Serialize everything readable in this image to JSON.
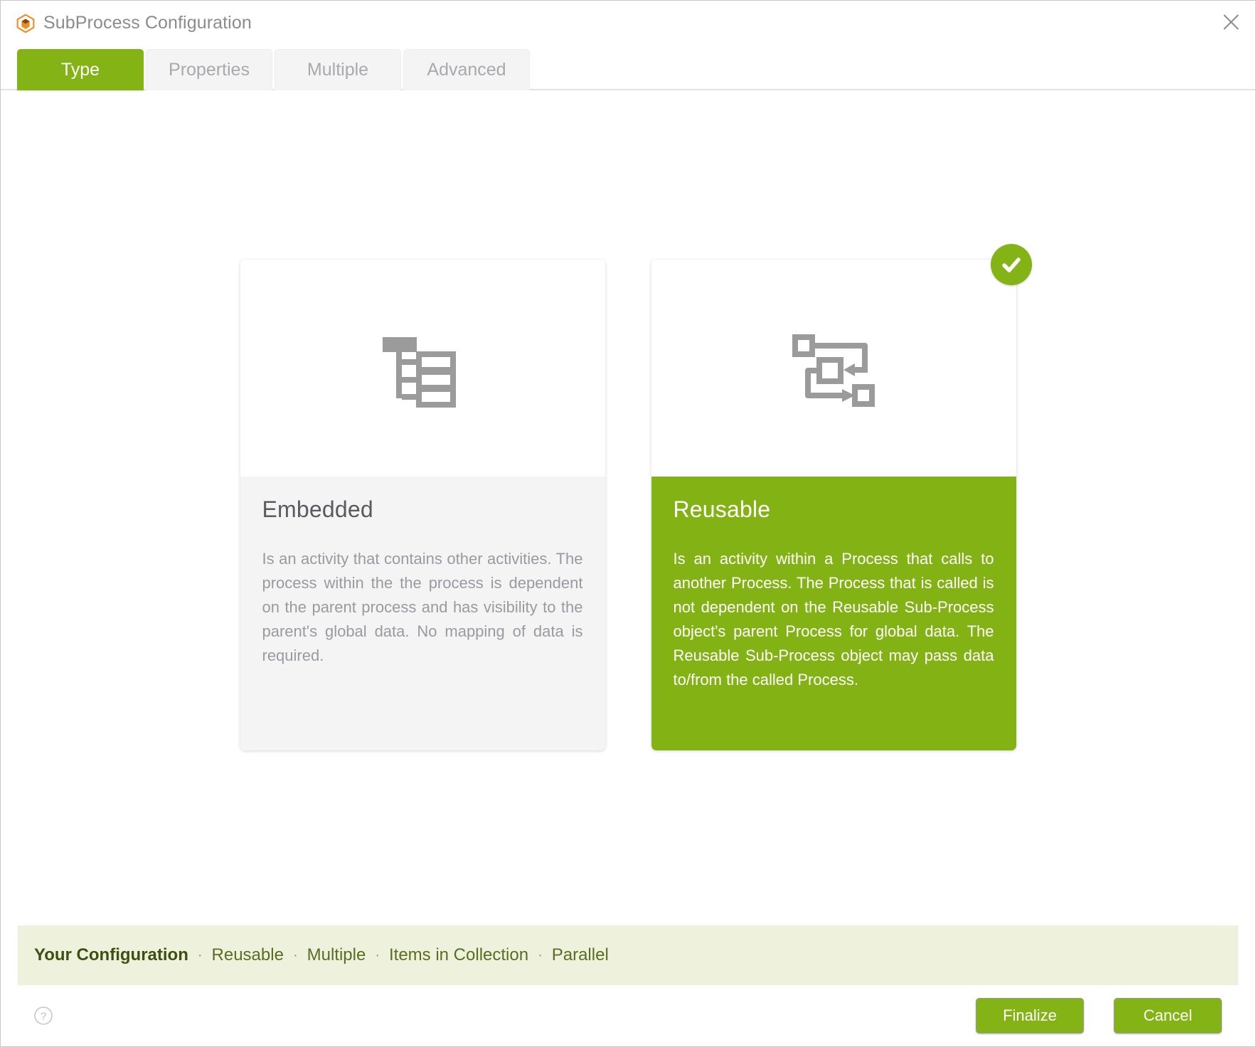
{
  "window": {
    "title": "SubProcess Configuration",
    "app_icon": "hexagon-logo-icon",
    "close_icon": "close-icon"
  },
  "tabs": [
    {
      "label": "Type",
      "active": true
    },
    {
      "label": "Properties",
      "active": false
    },
    {
      "label": "Multiple",
      "active": false
    },
    {
      "label": "Advanced",
      "active": false
    }
  ],
  "cards": [
    {
      "key": "embedded",
      "title": "Embedded",
      "icon": "hierarchy-tree-icon",
      "description": "Is an activity that contains other activities. The process within the the process is dependent on the parent process and has visibility to the parent's global data. No mapping of data is required.",
      "selected": false
    },
    {
      "key": "reusable",
      "title": "Reusable",
      "icon": "process-call-loop-icon",
      "description": "Is an activity within a Process that calls to another Process. The Process that is called is not dependent on the Reusable Sub-Process object's parent Process for global data. The Reusable Sub-Process object may pass data to/from the called Process.",
      "selected": true,
      "selected_badge_icon": "check-circle-icon"
    }
  ],
  "summary": {
    "label": "Your Configuration",
    "separator": "·",
    "items": [
      "Reusable",
      "Multiple",
      "Items in Collection",
      "Parallel"
    ]
  },
  "footer": {
    "help_icon": "question-mark-circle-icon",
    "finalize_label": "Finalize",
    "cancel_label": "Cancel"
  },
  "colors": {
    "accent_green": "#84b315",
    "card_selected_green": "#83b214",
    "summary_bg": "#eef2dc",
    "logo_orange": "#f08a24",
    "icon_gray": "#9b9b9b"
  }
}
